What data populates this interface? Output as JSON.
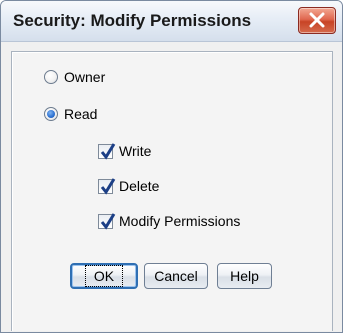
{
  "window": {
    "title": "Security: Modify Permissions",
    "close_icon": "close-icon"
  },
  "radios": [
    {
      "label": "Owner",
      "checked": false
    },
    {
      "label": "Read",
      "checked": true
    }
  ],
  "checkboxes": [
    {
      "label": "Write",
      "checked": true
    },
    {
      "label": "Delete",
      "checked": true
    },
    {
      "label": "Modify Permissions",
      "checked": true
    }
  ],
  "buttons": {
    "ok_label": "OK",
    "cancel_label": "Cancel",
    "help_label": "Help"
  },
  "colors": {
    "close_button": "#d05a3e",
    "radio_selected": "#2a6fd1",
    "checkmark": "#1c3f86"
  }
}
